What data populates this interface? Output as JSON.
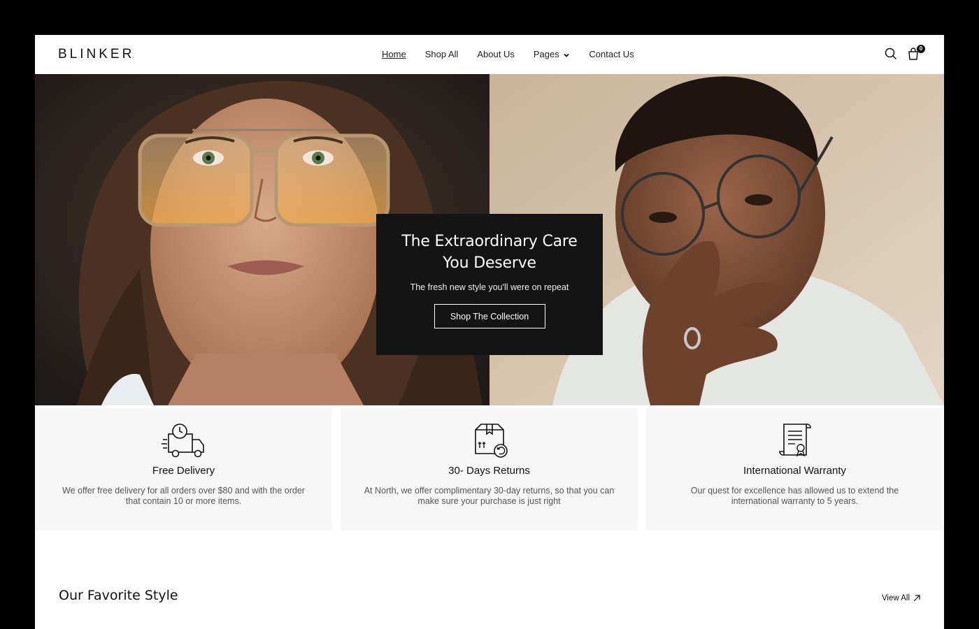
{
  "brand": {
    "logo": "BLINKER"
  },
  "nav": {
    "items": [
      {
        "label": "Home",
        "active": true
      },
      {
        "label": "Shop All"
      },
      {
        "label": "About Us"
      },
      {
        "label": "Pages",
        "has_dropdown": true
      },
      {
        "label": "Contact Us"
      }
    ]
  },
  "header_icons": {
    "search": "search-icon",
    "cart": "shopping-bag-icon",
    "cart_count": "0"
  },
  "hero": {
    "title": "The Extraordinary Care You Deserve",
    "subtitle": "The fresh new style you'll were on repeat",
    "button": "Shop The Collection"
  },
  "features": [
    {
      "icon": "delivery-truck-icon",
      "title": "Free Delivery",
      "desc": "We offer free delivery for all orders over $80 and with the order that contain 10 or more items."
    },
    {
      "icon": "returns-box-icon",
      "title": "30- Days Returns",
      "desc": "At North, we offer complimentary 30-day returns, so that you can make sure your purchase is just right"
    },
    {
      "icon": "warranty-certificate-icon",
      "title": "International Warranty",
      "desc": "Our quest for excellence has allowed us to extend the international warranty to 5 years."
    }
  ],
  "section": {
    "title": "Our Favorite Style",
    "view_all": "View All"
  },
  "colors": {
    "background": "#000000",
    "card": "#141414",
    "feature_bg": "#f7f7f7",
    "text": "#1a1a1a"
  }
}
